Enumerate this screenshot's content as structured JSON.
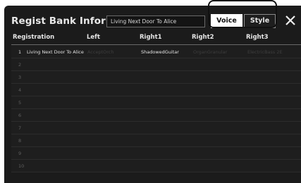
{
  "dialog": {
    "title": "Regist Bank Information",
    "bank_name": "Living Next Door To Alice",
    "tabs": [
      {
        "label": "Voice",
        "active": true
      },
      {
        "label": "Style",
        "active": false
      }
    ],
    "close_icon": "close-icon"
  },
  "table": {
    "columns": [
      "Registration",
      "Left",
      "Right1",
      "Right2",
      "Right3"
    ],
    "rows": [
      {
        "num": "1",
        "name": "Living Next Door To Alice",
        "left": "AcceptOrch",
        "right1": "ShadowedGuitar",
        "right2": "OrganGranular",
        "right3": "ElectricBass 2E"
      },
      {
        "num": "2",
        "name": "",
        "left": "",
        "right1": "",
        "right2": "",
        "right3": ""
      },
      {
        "num": "3",
        "name": "",
        "left": "",
        "right1": "",
        "right2": "",
        "right3": ""
      },
      {
        "num": "4",
        "name": "",
        "left": "",
        "right1": "",
        "right2": "",
        "right3": ""
      },
      {
        "num": "5",
        "name": "",
        "left": "",
        "right1": "",
        "right2": "",
        "right3": ""
      },
      {
        "num": "6",
        "name": "",
        "left": "",
        "right1": "",
        "right2": "",
        "right3": ""
      },
      {
        "num": "7",
        "name": "",
        "left": "",
        "right1": "",
        "right2": "",
        "right3": ""
      },
      {
        "num": "8",
        "name": "",
        "left": "",
        "right1": "",
        "right2": "",
        "right3": ""
      },
      {
        "num": "9",
        "name": "",
        "left": "",
        "right1": "",
        "right2": "",
        "right3": ""
      },
      {
        "num": "10",
        "name": "",
        "left": "",
        "right1": "",
        "right2": "",
        "right3": ""
      }
    ]
  },
  "colors": {
    "panel_bg": "#1b1b1b",
    "active_tab_bg": "#ffffff",
    "text": "#e6e6e6"
  }
}
